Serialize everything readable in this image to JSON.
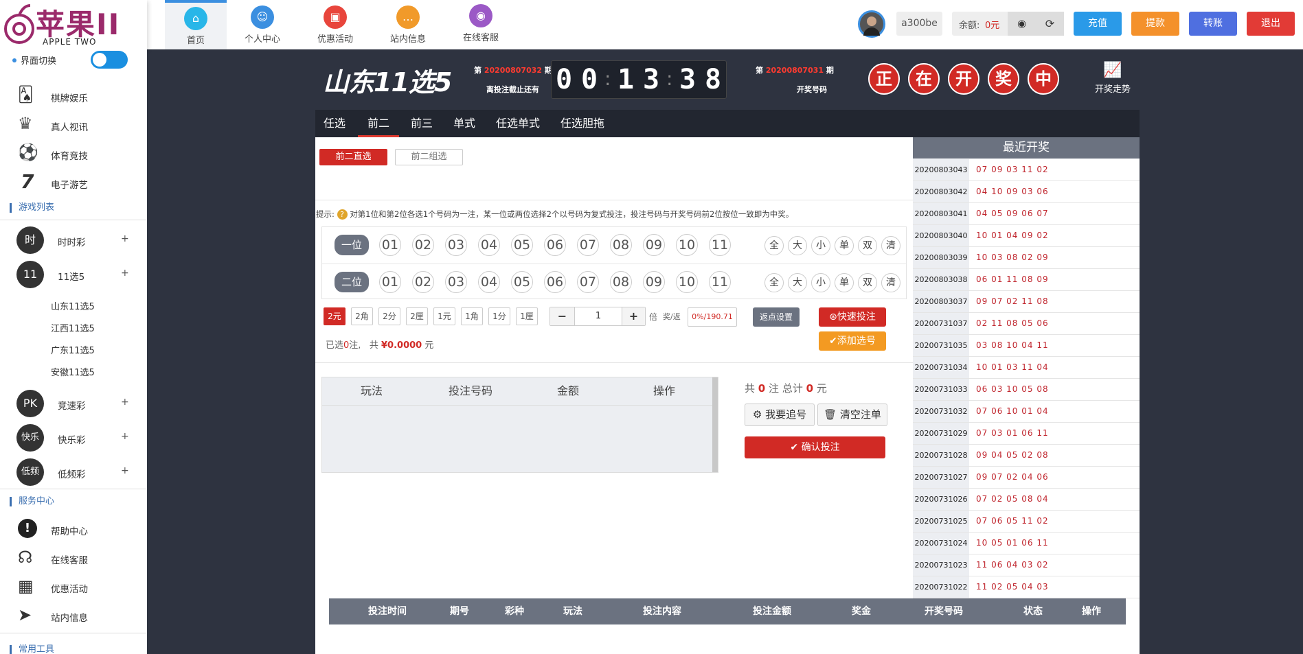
{
  "logo": {
    "cn": "苹果II",
    "en": "APPLE TWO"
  },
  "nav": [
    {
      "label": "首页",
      "icon": "home-icon",
      "color": "#29b6e8"
    },
    {
      "label": "个人中心",
      "icon": "user-icon",
      "color": "#3b8fe0"
    },
    {
      "label": "优惠活动",
      "icon": "gift-icon",
      "color": "#e8453c"
    },
    {
      "label": "站内信息",
      "icon": "message-icon",
      "color": "#f19a2a"
    },
    {
      "label": "在线客服",
      "icon": "service-icon",
      "color": "#9b59c6"
    }
  ],
  "user": {
    "username": "a300be",
    "balance_label": "余额:",
    "balance_value": "0元"
  },
  "buttons": {
    "recharge": "充值",
    "withdraw": "提款",
    "transfer": "转账",
    "logout": "退出"
  },
  "colors": {
    "recharge": "#2a9ae8",
    "withdraw": "#f4912b",
    "transfer": "#4f6fe0",
    "logout": "#e23b36",
    "accent_red": "#d12a25"
  },
  "sidebar": {
    "switch_label": "界面切换",
    "top_items": [
      {
        "label": "棋牌娱乐",
        "icon": "cards-icon"
      },
      {
        "label": "真人视讯",
        "icon": "live-dealer-icon"
      },
      {
        "label": "体育竞技",
        "icon": "soccer-icon"
      },
      {
        "label": "电子游艺",
        "icon": "slot-seven-icon"
      }
    ],
    "game_list_title": "游戏列表",
    "games": [
      {
        "badge": "时",
        "label": "时时彩",
        "plus": "+"
      },
      {
        "badge": "11",
        "label": "11选5",
        "plus": "+"
      },
      {
        "badge": "PK",
        "label": "竞速彩",
        "plus": "+"
      },
      {
        "badge": "快乐",
        "label": "快乐彩",
        "plus": "+"
      },
      {
        "badge": "低频",
        "label": "低频彩",
        "plus": "+"
      }
    ],
    "sub_games": [
      "山东11选5",
      "江西11选5",
      "广东11选5",
      "安徽11选5"
    ],
    "service_title": "服务中心",
    "service_items": [
      {
        "label": "帮助中心",
        "icon": "help-icon"
      },
      {
        "label": "在线客服",
        "icon": "headset-icon"
      },
      {
        "label": "优惠活动",
        "icon": "gift-icon"
      },
      {
        "label": "站内信息",
        "icon": "send-icon"
      }
    ],
    "tools_title": "常用工具"
  },
  "lottery": {
    "title": "山东11选5",
    "current_prefix": "第",
    "current_issue": "20200807032",
    "current_suffix": "期",
    "countdown_label": "离投注截止还有",
    "countdown": [
      "0",
      "0",
      "1",
      "3",
      "3",
      "8"
    ],
    "last_prefix": "第",
    "last_issue": "20200807031",
    "last_suffix": "期",
    "last_label": "开奖号码",
    "drawing": [
      "正",
      "在",
      "开",
      "奖",
      "中"
    ],
    "trend_label": "开奖走势"
  },
  "tabs": [
    "任选",
    "前二",
    "前三",
    "单式",
    "任选单式",
    "任选胆拖"
  ],
  "subtabs": [
    "前二直选",
    "前二组选"
  ],
  "hint": {
    "prefix": "提示:",
    "text": "对第1位和第2位各选1个号码为一注，某一位或两位选择2个以号码为复式投注，投注号码与开奖号码前2位按位一致即为中奖。"
  },
  "positions": [
    "一位",
    "二位"
  ],
  "numbers": [
    "01",
    "02",
    "03",
    "04",
    "05",
    "06",
    "07",
    "08",
    "09",
    "10",
    "11"
  ],
  "quick": [
    "全",
    "大",
    "小",
    "单",
    "双",
    "清"
  ],
  "units": [
    "2元",
    "2角",
    "2分",
    "2厘",
    "1元",
    "1角",
    "1分",
    "1厘"
  ],
  "multiplier": {
    "value": "1",
    "label": "倍",
    "odds_label": "奖/返",
    "odds_value": "0%/190.71",
    "rebate_btn": "返点设置"
  },
  "actions": {
    "quick_bet": "快速投注",
    "add_number": "添加选号"
  },
  "summary": {
    "selected_a": "已选",
    "count": "0",
    "selected_b": "注,",
    "total_a": "共",
    "currency": "¥",
    "amount": "0.0000",
    "unit": "元"
  },
  "cart": {
    "headers": [
      "玩法",
      "投注号码",
      "金额",
      "操作"
    ],
    "total_a": "共",
    "count": "0",
    "total_b": "注",
    "total_c": "总计",
    "sum": "0",
    "total_d": "元",
    "chase": "我要追号",
    "clear": "清空注单",
    "confirm": "确认投注"
  },
  "recent": {
    "title": "最近开奖",
    "rows": [
      {
        "issue": "20200803043",
        "nums": "07 09 03 11 02"
      },
      {
        "issue": "20200803042",
        "nums": "04 10 09 03 06"
      },
      {
        "issue": "20200803041",
        "nums": "04 05 09 06 07"
      },
      {
        "issue": "20200803040",
        "nums": "10 01 04 09 02"
      },
      {
        "issue": "20200803039",
        "nums": "10 03 08 02 09"
      },
      {
        "issue": "20200803038",
        "nums": "06 01 11 08 09"
      },
      {
        "issue": "20200803037",
        "nums": "09 07 02 11 08"
      },
      {
        "issue": "20200731037",
        "nums": "02 11 08 05 06"
      },
      {
        "issue": "20200731035",
        "nums": "03 08 10 04 11"
      },
      {
        "issue": "20200731034",
        "nums": "10 01 03 11 04"
      },
      {
        "issue": "20200731033",
        "nums": "06 03 10 05 08"
      },
      {
        "issue": "20200731032",
        "nums": "07 06 10 01 04"
      },
      {
        "issue": "20200731029",
        "nums": "07 03 01 06 11"
      },
      {
        "issue": "20200731028",
        "nums": "09 04 05 02 08"
      },
      {
        "issue": "20200731027",
        "nums": "09 07 02 04 06"
      },
      {
        "issue": "20200731026",
        "nums": "07 02 05 08 04"
      },
      {
        "issue": "20200731025",
        "nums": "07 06 05 11 02"
      },
      {
        "issue": "20200731024",
        "nums": "10 05 01 06 11"
      },
      {
        "issue": "20200731023",
        "nums": "11 06 04 03 02"
      },
      {
        "issue": "20200731022",
        "nums": "11 02 05 04 03"
      }
    ]
  },
  "bets_table": {
    "headers": [
      "投注时间",
      "期号",
      "彩种",
      "玩法",
      "投注内容",
      "投注金额",
      "奖金",
      "开奖号码",
      "状态",
      "操作"
    ]
  }
}
